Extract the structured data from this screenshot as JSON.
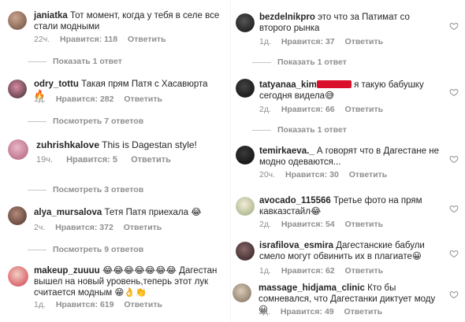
{
  "left": [
    {
      "username": "janiatka",
      "text": "Тот момент, когда у тебя в селе все стали модными",
      "time": "22ч.",
      "likes": "Нравится: 118",
      "reply": "Ответить",
      "replies": "Показать 1 ответ"
    },
    {
      "username": "odry_tottu",
      "text": "Такая прям Патя с Хасавюрта 🔥",
      "time": "1д.",
      "likes": "Нравится: 282",
      "reply": "Ответить",
      "replies": "Посмотреть 7 ответов"
    },
    {
      "username": "zuhrishkalove",
      "text": "This is Dagestan style!",
      "time": "19ч.",
      "likes": "Нравится: 5",
      "reply": "Ответить",
      "replies": "Посмотреть 3 ответов"
    },
    {
      "username": "alya_mursalova",
      "text": "Тетя Патя приехала 😂",
      "time": "2ч.",
      "likes": "Нравится: 372",
      "reply": "Ответить",
      "replies": "Посмотреть 9 ответов"
    },
    {
      "username": "makeup_zuuuu",
      "text": "😂😂😂😂😂😂😂 Дагестан вышел на новый уровень,теперь этот лук считается модным 😁👌👏",
      "time": "1д.",
      "likes": "Нравится: 619",
      "reply": "Ответить"
    }
  ],
  "right": [
    {
      "username": "bezdelnikpro",
      "text": "это что за Патимат со второго рынка",
      "time": "1д.",
      "likes": "Нравится: 37",
      "reply": "Ответить",
      "replies": "Показать 1 ответ"
    },
    {
      "username": "tatyanaa_kim",
      "text": "я такую бабушку сегодня видела😅",
      "time": "2д.",
      "likes": "Нравится: 66",
      "reply": "Ответить",
      "replies": "Показать 1 ответ"
    },
    {
      "username": "temirkaeva._",
      "text": "А говорят что в Дагестане не модно одеваются...",
      "time": "20ч.",
      "likes": "Нравится: 30",
      "reply": "Ответить"
    },
    {
      "username": "avocado_115566",
      "text": "Третье фото на прям кавказстайл😂",
      "time": "2д.",
      "likes": "Нравится: 54",
      "reply": "Ответить"
    },
    {
      "username": "israfilova_esmira",
      "text": "Дагестанские бабули смело могут обвинить их в плагиате😀",
      "time": "1д.",
      "likes": "Нравится: 62",
      "reply": "Ответить"
    },
    {
      "username": "massage_hidjama_clinic",
      "text": "Кто бы сомневался, что Дагестанки диктует моду 😀",
      "time": "3д.",
      "likes": "Нравится: 49",
      "reply": "Ответить"
    }
  ],
  "colors": {
    "muted": "#8e8e8e",
    "text": "#262626",
    "redaction": "#d90f2c"
  },
  "icons": {
    "like": "heart-outline-icon"
  }
}
